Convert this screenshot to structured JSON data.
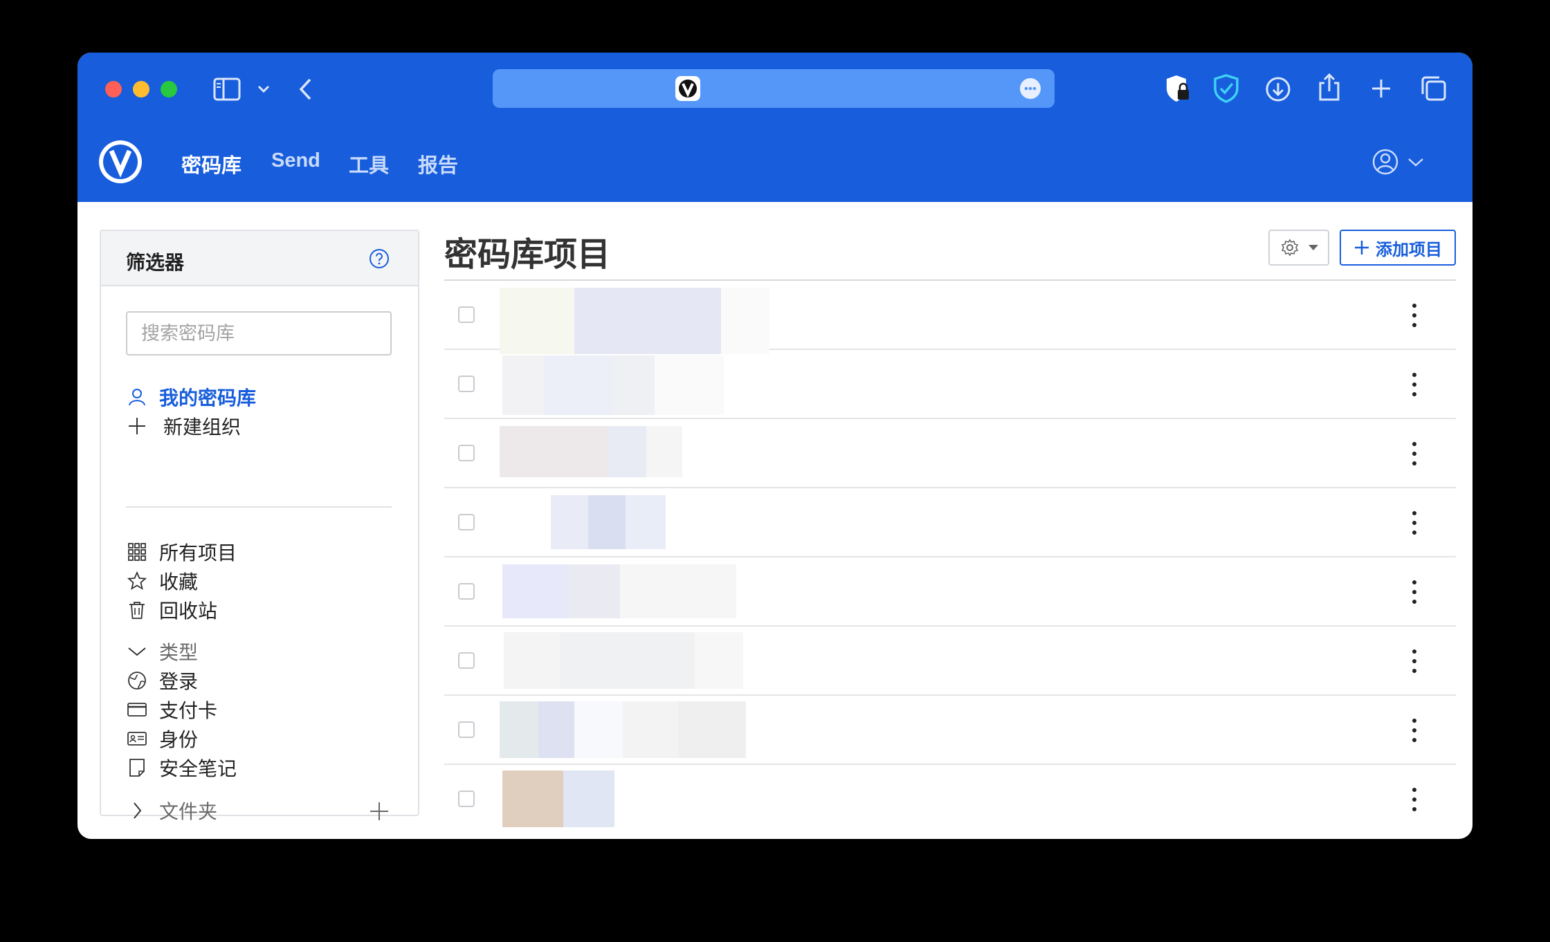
{
  "browser": {
    "toolbar_icons": [
      "sidebar-icon",
      "chevron-down-icon",
      "back-icon",
      "privacy-report-icon",
      "bitwarden-extension-icon",
      "downloads-icon",
      "share-icon",
      "new-tab-icon",
      "tab-overview-icon"
    ],
    "address_bar_icon": "bitwarden-favicon",
    "accent": "#175ddc"
  },
  "nav": {
    "items": [
      {
        "label": "密码库",
        "active": true
      },
      {
        "label": "Send"
      },
      {
        "label": "工具"
      },
      {
        "label": "报告"
      }
    ]
  },
  "filter": {
    "title": "筛选器",
    "search_placeholder": "搜索密码库",
    "my_vault": "我的密码库",
    "new_org": "新建组织",
    "all_items": "所有项目",
    "favorites": "收藏",
    "trash": "回收站",
    "types_header": "类型",
    "types": [
      "登录",
      "支付卡",
      "身份",
      "安全笔记"
    ],
    "folders_header": "文件夹"
  },
  "main": {
    "title": "密码库项目",
    "add_item_label": "添加项目"
  }
}
